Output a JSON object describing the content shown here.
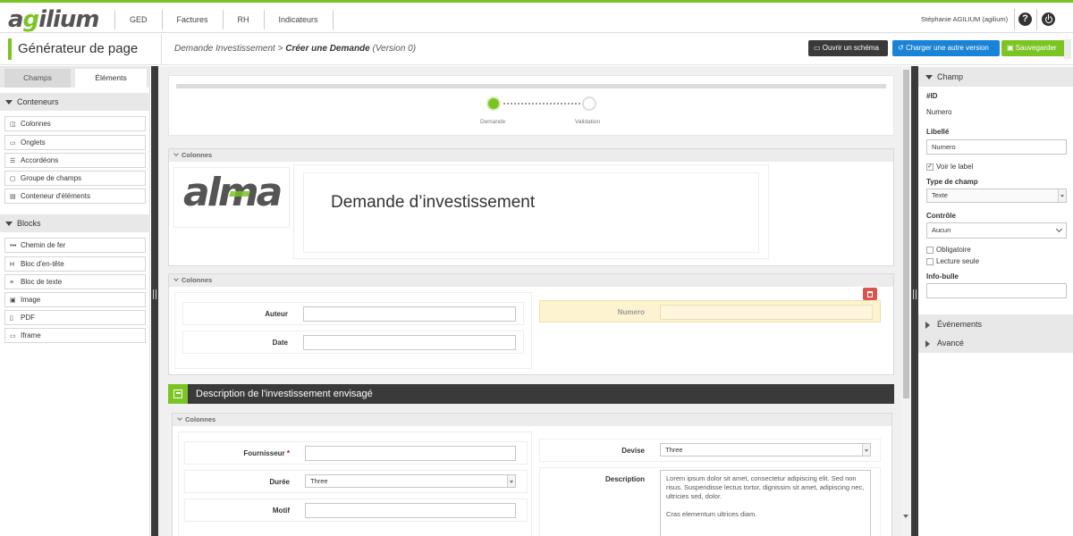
{
  "app": {
    "logo_prefix": "a",
    "logo_highlight": "g",
    "logo_suffix": "ilium",
    "nav": [
      "GED",
      "Factures",
      "RH",
      "Indicateurs"
    ],
    "user": "Stéphanie AGILIUM (agilium)",
    "help_glyph": "?"
  },
  "header": {
    "title": "Générateur de page",
    "crumb_root": "Demande Investissement",
    "crumb_sep": " > ",
    "crumb_page": "Créer une Demande",
    "crumb_version": " (Version 0)",
    "btn_schema": "Ouvrir un schéma",
    "btn_version": "Charger une autre version",
    "btn_save": "Sauvegarder"
  },
  "left": {
    "tab_champs": "Champs",
    "tab_elements": "Éléments",
    "conteneurs_title": "Conteneurs",
    "conteneurs": [
      {
        "glyph": "◫",
        "label": "Colonnes"
      },
      {
        "glyph": "▭",
        "label": "Onglets"
      },
      {
        "glyph": "☰",
        "label": "Accordéons"
      },
      {
        "glyph": "▢",
        "label": "Groupe de champs"
      },
      {
        "glyph": "▤",
        "label": "Conteneur d'éléments"
      }
    ],
    "blocks_title": "Blocks",
    "blocks": [
      {
        "glyph": "•••",
        "label": "Chemin de fer"
      },
      {
        "glyph": "H",
        "label": "Bloc d'en-tête"
      },
      {
        "glyph": "≡",
        "label": "Bloc de texte"
      },
      {
        "glyph": "▣",
        "label": "Image"
      },
      {
        "glyph": "▯",
        "label": "PDF"
      },
      {
        "glyph": "▭",
        "label": "Iframe"
      }
    ]
  },
  "canvas": {
    "steps": [
      "Demande",
      "Validation"
    ],
    "colonnes_label": "Colonnes",
    "logo_text": "alma",
    "main_title": "Demande d’investissement",
    "fields": {
      "auteur": "Auteur",
      "date": "Date",
      "numero": "Numero",
      "fournisseur": "Fournisseur",
      "required_mark": "*",
      "duree": "Durée",
      "duree_value": "Three",
      "motif": "Motif",
      "devise": "Devise",
      "devise_value": "Three",
      "description": "Description",
      "description_p1": "Lorem ipsum dolor sit amet, consectetur adipiscing elit. Sed non risus. Suspendisse lectus tortor, dignissim sit amet, adipiscing nec, ultricies sed, dolor.",
      "description_p2": "Cras elementum ultrices diam."
    },
    "section_title": "Description de l'investissement envisagé"
  },
  "right": {
    "champ_title": "Champ",
    "id_label": "#ID",
    "id_value": "Numero",
    "libelle_label": "Libellé",
    "libelle_value": "Numero",
    "voir_label": "Voir le label",
    "type_label": "Type de champ",
    "type_value": "Texte",
    "controle_label": "Contrôle",
    "controle_value": "Aucun",
    "obligatoire": "Obligatoire",
    "lecture_seule": "Lecture seule",
    "infobulle_label": "Info-bulle",
    "evenements": "Événements",
    "avance": "Avancé"
  },
  "colors": {
    "accent": "#7cc423",
    "blue": "#1a83d6",
    "dark": "#3a3a3a",
    "delete": "#d9534f",
    "highlight": "#fdf3d0"
  }
}
